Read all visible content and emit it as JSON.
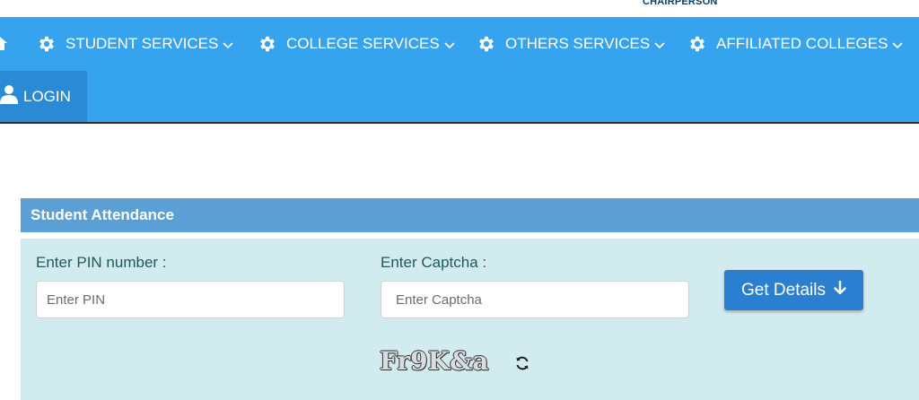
{
  "header": {
    "chairperson_label": "CHAIRPERSON"
  },
  "nav": {
    "items": [
      {
        "label": "STUDENT SERVICES",
        "icon": "gear-icon"
      },
      {
        "label": "COLLEGE SERVICES",
        "icon": "gear-icon"
      },
      {
        "label": "OTHERS SERVICES",
        "icon": "gear-icon"
      },
      {
        "label": "AFFILIATED COLLEGES",
        "icon": "gear-icon"
      }
    ],
    "login_label": "LOGIN"
  },
  "panel": {
    "title": "Student Attendance",
    "pin_label": "Enter PIN number :",
    "pin_placeholder": "Enter PIN",
    "pin_value": "",
    "captcha_label": "Enter Captcha :",
    "captcha_placeholder": "Enter Captcha",
    "captcha_value": "",
    "captcha_text": "Fr9K&a",
    "submit_label": "Get Details"
  },
  "colors": {
    "nav_bg": "#36a3ee",
    "login_bg": "#2a8ad6",
    "panel_header_bg": "#5b9fd4",
    "panel_body_bg": "#d1ebef",
    "button_bg": "#2a7fd0"
  }
}
